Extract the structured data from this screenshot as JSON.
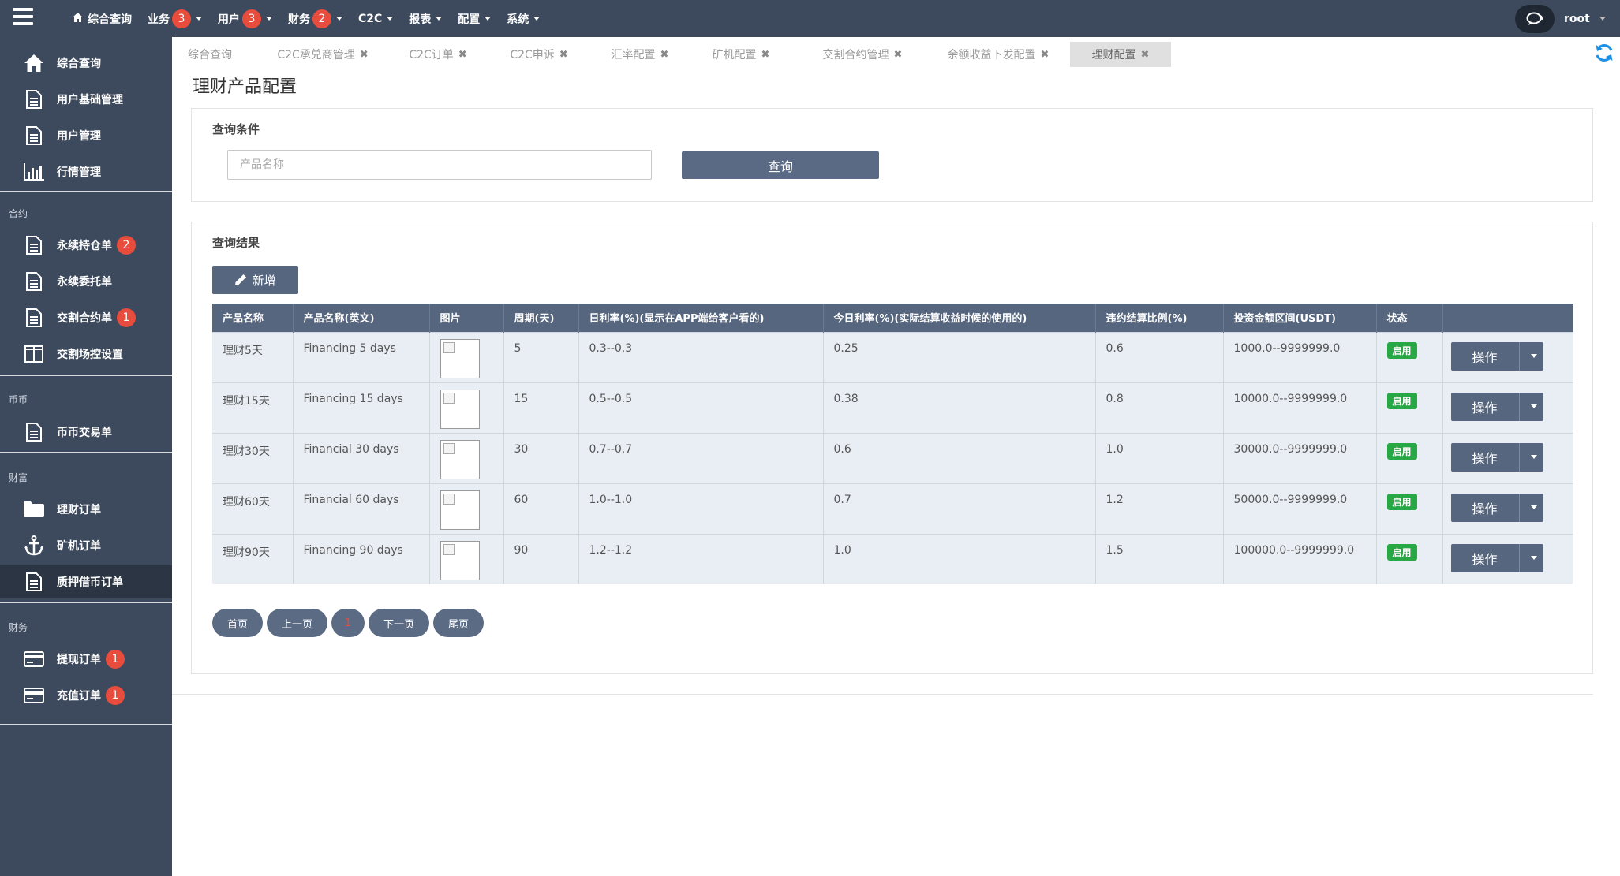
{
  "topnav": {
    "items": [
      {
        "label": "综合查询",
        "icon": "home-icon",
        "badge": "",
        "dropdown": false
      },
      {
        "label": "业务",
        "badge": "3",
        "dropdown": true
      },
      {
        "label": "用户",
        "badge": "3",
        "dropdown": true
      },
      {
        "label": "财务",
        "badge": "2",
        "dropdown": true
      },
      {
        "label": "C2C",
        "badge": "",
        "dropdown": true
      },
      {
        "label": "报表",
        "badge": "",
        "dropdown": true
      },
      {
        "label": "配置",
        "badge": "",
        "dropdown": true
      },
      {
        "label": "系统",
        "badge": "",
        "dropdown": true
      }
    ],
    "user": "root"
  },
  "sidebar": {
    "items": [
      {
        "label": "综合查询",
        "icon": "home-icon"
      },
      {
        "label": "用户基础管理",
        "icon": "document-icon"
      },
      {
        "label": "用户管理",
        "icon": "document-icon"
      },
      {
        "label": "行情管理",
        "icon": "bar-chart-icon"
      },
      {
        "label": "永续持仓单",
        "icon": "document-icon",
        "badge": "2"
      },
      {
        "label": "永续委托单",
        "icon": "document-icon"
      },
      {
        "label": "交割合约单",
        "icon": "document-icon",
        "badge": "1"
      },
      {
        "label": "交割场控设置",
        "icon": "columns-icon"
      },
      {
        "label": "币币交易单",
        "icon": "document-icon"
      },
      {
        "label": "理财订单",
        "icon": "folder-icon"
      },
      {
        "label": "矿机订单",
        "icon": "anchor-icon"
      },
      {
        "label": "质押借币订单",
        "icon": "document-icon"
      },
      {
        "label": "提现订单",
        "icon": "credit-card-icon",
        "badge": "1"
      },
      {
        "label": "充值订单",
        "icon": "credit-card-icon",
        "badge": "1"
      }
    ],
    "sections": [
      "合约",
      "币币",
      "财富",
      "财务"
    ]
  },
  "tabs": [
    {
      "label": "综合查询",
      "closable": false
    },
    {
      "label": "C2C承兑商管理",
      "closable": true
    },
    {
      "label": "C2C订单",
      "closable": true
    },
    {
      "label": "C2C申诉",
      "closable": true
    },
    {
      "label": "汇率配置",
      "closable": true
    },
    {
      "label": "矿机配置",
      "closable": true
    },
    {
      "label": "交割合约管理",
      "closable": true
    },
    {
      "label": "余额收益下发配置",
      "closable": true
    },
    {
      "label": "理财配置",
      "closable": true,
      "active": true
    }
  ],
  "page": {
    "title": "理财产品配置",
    "query_title": "查询条件",
    "search_placeholder": "产品名称",
    "search_button": "查询",
    "results_title": "查询结果",
    "add_button": "新增"
  },
  "table": {
    "columns": [
      "产品名称",
      "产品名称(英文)",
      "图片",
      "周期(天)",
      "日利率(%)(显示在APP端给客户看的)",
      "今日利率(%)(实际结算收益时候的使用的)",
      "违约结算比例(%)",
      "投资金额区间(USDT)",
      "状态",
      ""
    ],
    "rows": [
      {
        "name": "理财5天",
        "name_en": "Financing 5 days",
        "cycle": "5",
        "daily_rate": "0.3--0.3",
        "today_rate": "0.25",
        "penalty": "0.6",
        "range": "1000.0--9999999.0",
        "status": "启用",
        "action": "操作"
      },
      {
        "name": "理财15天",
        "name_en": "Financing 15 days",
        "cycle": "15",
        "daily_rate": "0.5--0.5",
        "today_rate": "0.38",
        "penalty": "0.8",
        "range": "10000.0--9999999.0",
        "status": "启用",
        "action": "操作"
      },
      {
        "name": "理财30天",
        "name_en": "Financial 30 days",
        "cycle": "30",
        "daily_rate": "0.7--0.7",
        "today_rate": "0.6",
        "penalty": "1.0",
        "range": "30000.0--9999999.0",
        "status": "启用",
        "action": "操作"
      },
      {
        "name": "理财60天",
        "name_en": "Financial 60 days",
        "cycle": "60",
        "daily_rate": "1.0--1.0",
        "today_rate": "0.7",
        "penalty": "1.2",
        "range": "50000.0--9999999.0",
        "status": "启用",
        "action": "操作"
      },
      {
        "name": "理财90天",
        "name_en": "Financing 90 days",
        "cycle": "90",
        "daily_rate": "1.2--1.2",
        "today_rate": "1.0",
        "penalty": "1.5",
        "range": "100000.0--9999999.0",
        "status": "启用",
        "action": "操作"
      }
    ]
  },
  "pager": {
    "first": "首页",
    "prev": "上一页",
    "current": "1",
    "next": "下一页",
    "last": "尾页"
  },
  "colors": {
    "nav_bg": "#3d4a5d",
    "button": "#56667f",
    "badge": "#e74c3c",
    "status_green": "#27a844"
  }
}
